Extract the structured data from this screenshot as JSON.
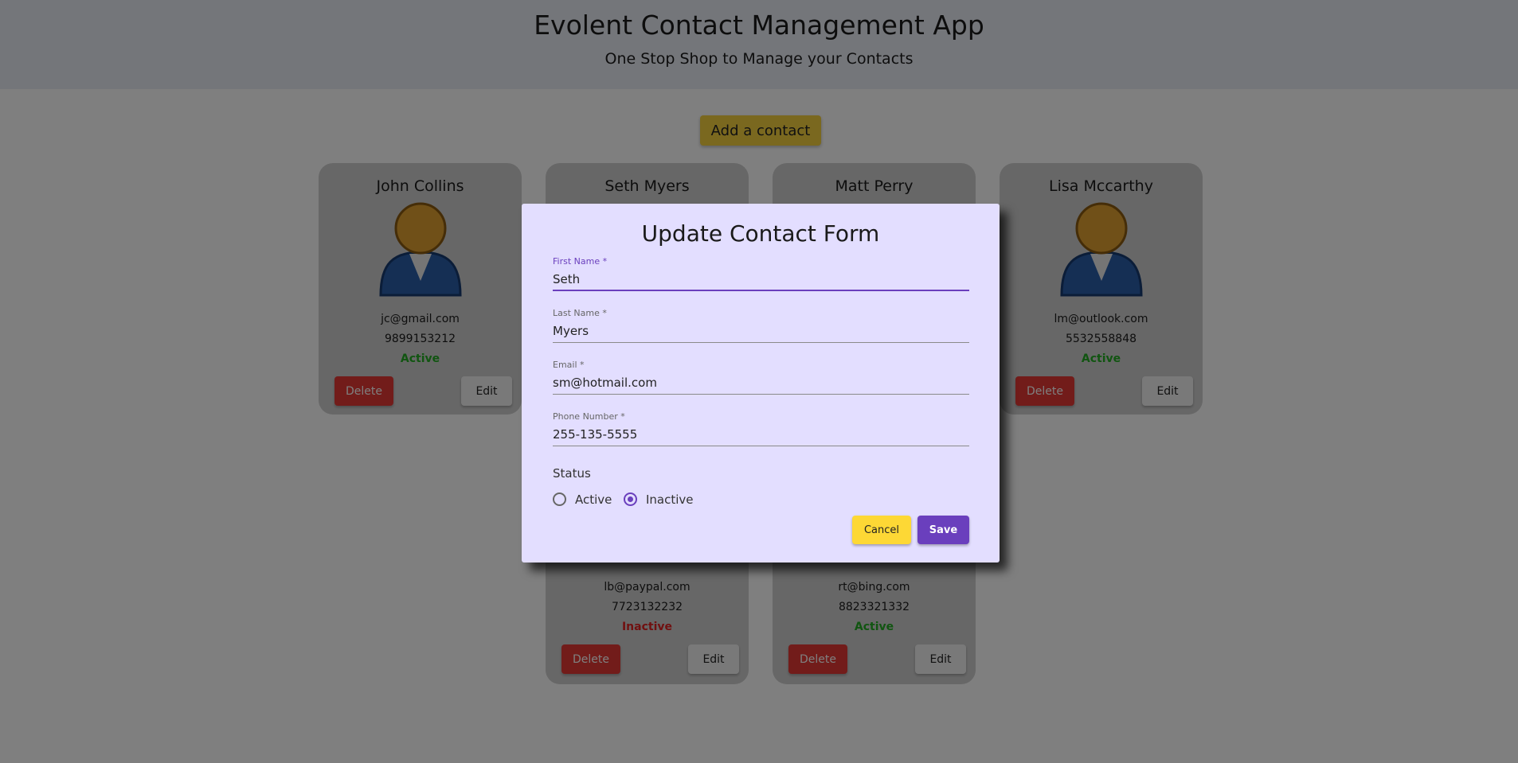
{
  "header": {
    "title": "Evolent Contact Management App",
    "subtitle": "One Stop Shop to Manage your Contacts"
  },
  "add_button_label": "Add a contact",
  "contacts_top_row": [
    {
      "name": "John Collins",
      "email": "jc@gmail.com",
      "phone": "9899153212",
      "status": "Active"
    },
    {
      "name": "Seth Myers"
    },
    {
      "name": "Matt Perry"
    },
    {
      "name": "Lisa Mccarthy",
      "email": "lm@outlook.com",
      "phone": "5532558848",
      "status": "Active"
    }
  ],
  "contacts_bottom_row": [
    {
      "email": "lb@paypal.com",
      "phone": "7723132232",
      "status": "Inactive"
    },
    {
      "email": "rt@bing.com",
      "phone": "8823321332",
      "status": "Active"
    }
  ],
  "card_buttons": {
    "delete": "Delete",
    "edit": "Edit"
  },
  "status_colors": {
    "active": "#22aa22",
    "inactive": "#e02020"
  },
  "modal": {
    "title": "Update Contact Form",
    "fields": [
      {
        "label": "First Name *",
        "value": "Seth",
        "focused": true
      },
      {
        "label": "Last Name *",
        "value": "Myers"
      },
      {
        "label": "Email *",
        "value": "sm@hotmail.com"
      },
      {
        "label": "Phone Number *",
        "value": "255-135-5555"
      }
    ],
    "status_label": "Status",
    "status_options": [
      "Active",
      "Inactive"
    ],
    "status_selected": "Inactive",
    "cancel_label": "Cancel",
    "save_label": "Save"
  },
  "colors": {
    "accent": "#6a3fbd",
    "modal_bg": "#e3deff",
    "add_button": "#f4d03f",
    "delete_button": "#e53935"
  },
  "icons": {
    "avatar": "user-avatar-icon"
  }
}
